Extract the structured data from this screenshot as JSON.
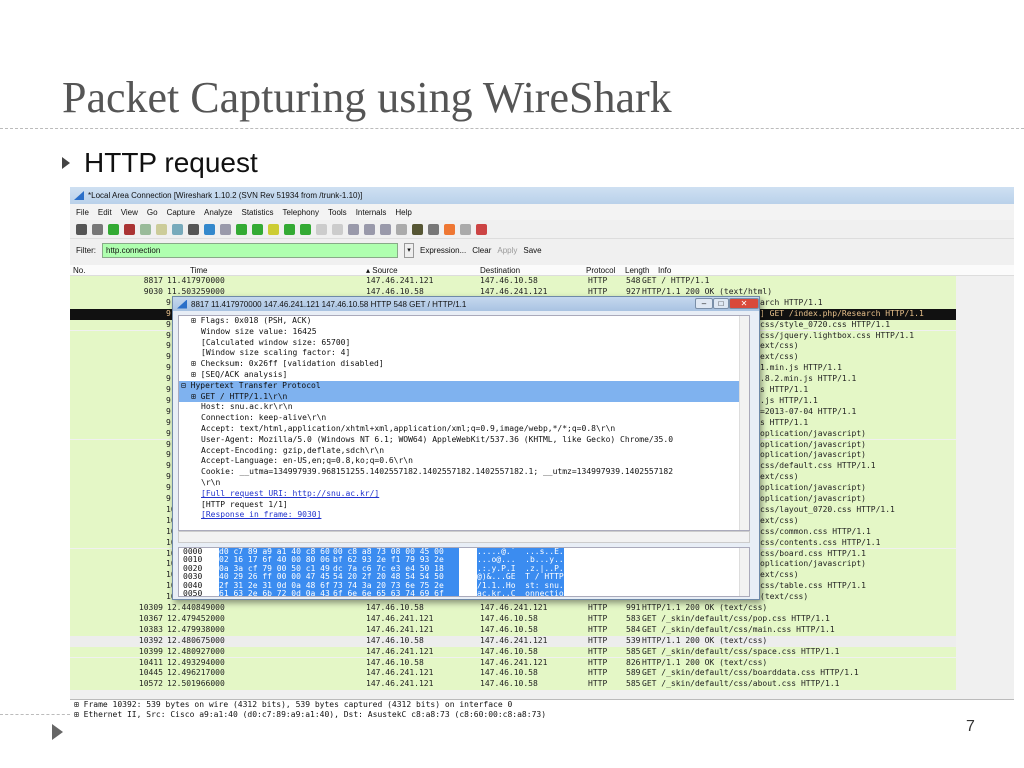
{
  "slide": {
    "title": "Packet Capturing using WireShark",
    "bullet": "HTTP request",
    "page_number": "7"
  },
  "window": {
    "title": "*Local Area Connection   [Wireshark 1.10.2  (SVN Rev 51934 from /trunk-1.10)]"
  },
  "menu": [
    "File",
    "Edit",
    "View",
    "Go",
    "Capture",
    "Analyze",
    "Statistics",
    "Telephony",
    "Tools",
    "Internals",
    "Help"
  ],
  "filter": {
    "label": "Filter:",
    "value": "http.connection",
    "expression": "Expression...",
    "clear": "Clear",
    "apply": "Apply",
    "save": "Save"
  },
  "columns": {
    "no": "No.",
    "time": "Time",
    "source": "Source",
    "destination": "Destination",
    "protocol": "Protocol",
    "length": "Length",
    "info": "Info"
  },
  "packets": [
    {
      "no": "8817",
      "time": "11.417970000",
      "src": "147.46.241.121",
      "dst": "147.46.10.58",
      "proto": "HTTP",
      "len": "548",
      "info": "GET / HTTP/1.1"
    },
    {
      "no": "9030",
      "time": "11.503259000",
      "src": "147.46.10.58",
      "dst": "147.46.241.121",
      "proto": "HTTP",
      "len": "927",
      "info": "HTTP/1.1 200 OK  (text/html)"
    }
  ],
  "hidden_rows": [
    {
      "no": "9",
      "tail": "arch HTTP/1.1"
    },
    {
      "no": "9",
      "tail": "] GET /index.php/Research HTTP/1.1",
      "selected": true
    },
    {
      "no": "9",
      "tail": "css/style_0720.css HTTP/1.1"
    },
    {
      "no": "9",
      "tail": "css/jquery.lightbox.css HTTP/1.1"
    },
    {
      "no": "9",
      "tail": "ext/css)"
    },
    {
      "no": "9",
      "tail": "ext/css)"
    },
    {
      "no": "9",
      "tail": "1.min.js HTTP/1.1"
    },
    {
      "no": "9",
      "tail": ".8.2.min.js HTTP/1.1"
    },
    {
      "no": "9",
      "tail": "s HTTP/1.1"
    },
    {
      "no": "9",
      "tail": ".js HTTP/1.1"
    },
    {
      "no": "9",
      "tail": "=2013-07-04 HTTP/1.1"
    },
    {
      "no": "9",
      "tail": "s HTTP/1.1"
    },
    {
      "no": "9",
      "tail": "oplication/javascript)"
    },
    {
      "no": "9",
      "tail": "oplication/javascript)"
    },
    {
      "no": "9",
      "tail": "oplication/javascript)"
    },
    {
      "no": "9",
      "tail": "css/default.css HTTP/1.1"
    },
    {
      "no": "9",
      "tail": "ext/css)"
    },
    {
      "no": "9",
      "tail": "oplication/javascript)"
    },
    {
      "no": "9",
      "tail": "oplication/javascript)"
    },
    {
      "no": "10",
      "tail": "css/layout_0720.css HTTP/1.1"
    },
    {
      "no": "10",
      "tail": "ext/css)"
    },
    {
      "no": "10",
      "tail": "css/common.css HTTP/1.1"
    },
    {
      "no": "10",
      "tail": "css/contents.css HTTP/1.1"
    },
    {
      "no": "10",
      "tail": "css/board.css HTTP/1.1"
    },
    {
      "no": "10",
      "tail": "oplication/javascript)"
    },
    {
      "no": "10",
      "tail": "ext/css)"
    },
    {
      "no": "10",
      "tail": "css/table.css HTTP/1.1"
    },
    {
      "no": "10",
      "tail": "(text/css)"
    }
  ],
  "packets_after": [
    {
      "no": "10309",
      "time": "12.440849000",
      "src": "147.46.10.58",
      "dst": "147.46.241.121",
      "proto": "HTTP",
      "len": "991",
      "info": "HTTP/1.1 200 OK  (text/css)"
    },
    {
      "no": "10367",
      "time": "12.479452000",
      "src": "147.46.241.121",
      "dst": "147.46.10.58",
      "proto": "HTTP",
      "len": "583",
      "info": "GET /_skin/default/css/pop.css HTTP/1.1"
    },
    {
      "no": "10383",
      "time": "12.479938000",
      "src": "147.46.241.121",
      "dst": "147.46.10.58",
      "proto": "HTTP",
      "len": "584",
      "info": "GET /_skin/default/css/main.css HTTP/1.1"
    },
    {
      "no": "10392",
      "time": "12.480675000",
      "src": "147.46.10.58",
      "dst": "147.46.241.121",
      "proto": "HTTP",
      "len": "539",
      "info": "HTTP/1.1 200 OK  (text/css)",
      "gray": true
    },
    {
      "no": "10399",
      "time": "12.480927000",
      "src": "147.46.241.121",
      "dst": "147.46.10.58",
      "proto": "HTTP",
      "len": "585",
      "info": "GET /_skin/default/css/space.css HTTP/1.1"
    },
    {
      "no": "10411",
      "time": "12.493294000",
      "src": "147.46.10.58",
      "dst": "147.46.241.121",
      "proto": "HTTP",
      "len": "826",
      "info": "HTTP/1.1 200 OK  (text/css)"
    },
    {
      "no": "10445",
      "time": "12.496217000",
      "src": "147.46.241.121",
      "dst": "147.46.10.58",
      "proto": "HTTP",
      "len": "589",
      "info": "GET /_skin/default/css/boarddata.css HTTP/1.1"
    },
    {
      "no": "10572",
      "time": "12.501966000",
      "src": "147.46.241.121",
      "dst": "147.46.10.58",
      "proto": "HTTP",
      "len": "585",
      "info": "GET /_skin/default/css/about.css HTTP/1.1"
    }
  ],
  "status": {
    "frame": "Frame 10392: 539 bytes on wire (4312 bits), 539 bytes captured (4312 bits) on interface 0",
    "ethernet": "Ethernet II, Src: Cisco_a9:a1:40 (d0:c7:89:a9:a1:40), Dst: AsustekC_c8:a8:73 (c8:60:00:c8:a8:73)"
  },
  "popup": {
    "title": "8817 11.417970000 147.46.241.121 147.46.10.58 HTTP 548 GET / HTTP/1.1",
    "tree": [
      {
        "t": "Flags: 0x018 (PSH, ACK)",
        "ind": 1,
        "exp": "+"
      },
      {
        "t": "Window size value: 16425",
        "ind": 2
      },
      {
        "t": "[Calculated window size: 65700]",
        "ind": 2
      },
      {
        "t": "[Window size scaling factor: 4]",
        "ind": 2
      },
      {
        "t": "Checksum: 0x26ff [validation disabled]",
        "ind": 1,
        "exp": "+"
      },
      {
        "t": "[SEQ/ACK analysis]",
        "ind": 1,
        "exp": "+"
      },
      {
        "t": "Hypertext Transfer Protocol",
        "ind": 0,
        "exp": "-",
        "hl": true
      },
      {
        "t": "GET / HTTP/1.1\\r\\n",
        "ind": 1,
        "exp": "+",
        "hl": true
      },
      {
        "t": "Host: snu.ac.kr\\r\\n",
        "ind": 2
      },
      {
        "t": "Connection: keep-alive\\r\\n",
        "ind": 2
      },
      {
        "t": "Accept: text/html,application/xhtml+xml,application/xml;q=0.9,image/webp,*/*;q=0.8\\r\\n",
        "ind": 2
      },
      {
        "t": "User-Agent: Mozilla/5.0 (Windows NT 6.1; WOW64) AppleWebKit/537.36 (KHTML, like Gecko) Chrome/35.0",
        "ind": 2
      },
      {
        "t": "Accept-Encoding: gzip,deflate,sdch\\r\\n",
        "ind": 2
      },
      {
        "t": "Accept-Language: en-US,en;q=0.8,ko;q=0.6\\r\\n",
        "ind": 2
      },
      {
        "t": "Cookie: __utma=134997939.968151255.1402557182.1402557182.1402557182.1; __utmz=134997939.1402557182",
        "ind": 2
      },
      {
        "t": "\\r\\n",
        "ind": 2
      },
      {
        "t": "[Full request URI: http://snu.ac.kr/]",
        "ind": 2,
        "link": true
      },
      {
        "t": "[HTTP request 1/1]",
        "ind": 2
      },
      {
        "t": "[Response in frame: 9030]",
        "ind": 2,
        "link": true
      }
    ],
    "hex": [
      {
        "off": "0000",
        "a": "d0 c7 89 a9 a1 40 c8 60",
        "b": "00 c8 a8 73 08 00 45 00",
        "asc": ".....@.`  ...s..E."
      },
      {
        "off": "0010",
        "a": "02 16 17 6f 40 00 80 06",
        "b": "bf 62 93 2e f1 79 93 2e",
        "asc": "...o@...  .b...y.."
      },
      {
        "off": "0020",
        "a": "0a 3a cf 79 00 50 c1 49",
        "b": "dc 7a c6 7c e3 e4 50 18",
        "asc": ".:.y.P.I  .z.|..P."
      },
      {
        "off": "0030",
        "a": "40 29 26 ff 00 00 47 45",
        "b": "54 20 2f 20 48 54 54 50",
        "asc": "@)&...GE  T / HTTP"
      },
      {
        "off": "0040",
        "a": "2f 31 2e 31 0d 0a 48 6f",
        "b": "73 74 3a 20 73 6e 75 2e",
        "asc": "/1.1..Ho  st: snu."
      },
      {
        "off": "0050",
        "a": "61 63 2e 6b 72 0d 0a 43",
        "b": "6f 6e 6e 65 63 74 69 6f",
        "asc": "ac.kr..C  onnectio"
      }
    ]
  }
}
